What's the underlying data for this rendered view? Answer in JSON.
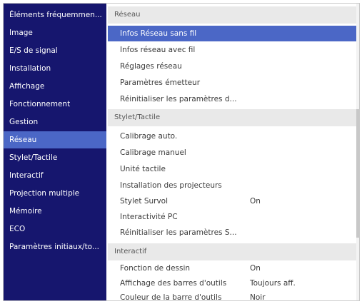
{
  "sidebar": {
    "items": [
      {
        "label": "Éléments fréquemmen..."
      },
      {
        "label": "Image"
      },
      {
        "label": "E/S de signal"
      },
      {
        "label": "Installation"
      },
      {
        "label": "Affichage"
      },
      {
        "label": "Fonctionnement"
      },
      {
        "label": "Gestion"
      },
      {
        "label": "Réseau"
      },
      {
        "label": "Stylet/Tactile"
      },
      {
        "label": "Interactif"
      },
      {
        "label": "Projection multiple"
      },
      {
        "label": "Mémoire"
      },
      {
        "label": "ECO"
      },
      {
        "label": "Paramètres initiaux/to..."
      }
    ]
  },
  "sections": {
    "reseau": {
      "title": "Réseau",
      "rows": [
        {
          "label": "Infos Réseau sans fil",
          "value": ""
        },
        {
          "label": "Infos réseau avec fil",
          "value": ""
        },
        {
          "label": "Réglages réseau",
          "value": ""
        },
        {
          "label": "Paramètres émetteur",
          "value": ""
        },
        {
          "label": "Réinitialiser les paramètres d...",
          "value": ""
        }
      ]
    },
    "stylet": {
      "title": "Stylet/Tactile",
      "rows": [
        {
          "label": "Calibrage auto.",
          "value": ""
        },
        {
          "label": "Calibrage manuel",
          "value": ""
        },
        {
          "label": "Unité tactile",
          "value": ""
        },
        {
          "label": "Installation des projecteurs",
          "value": ""
        },
        {
          "label": "Stylet Survol",
          "value": "On"
        },
        {
          "label": "Interactivité PC",
          "value": ""
        },
        {
          "label": "Réinitialiser les paramètres S...",
          "value": ""
        }
      ]
    },
    "interactif": {
      "title": "Interactif",
      "rows": [
        {
          "label": "Fonction de dessin",
          "value": "On"
        },
        {
          "label": "Affichage des barres d'outils",
          "value": "Toujours aff."
        },
        {
          "label": "Couleur de la barre d'outils",
          "value": "Noir"
        }
      ]
    }
  },
  "colors": {
    "sidebar_bg": "#16166e",
    "highlight": "#4b67c6"
  }
}
